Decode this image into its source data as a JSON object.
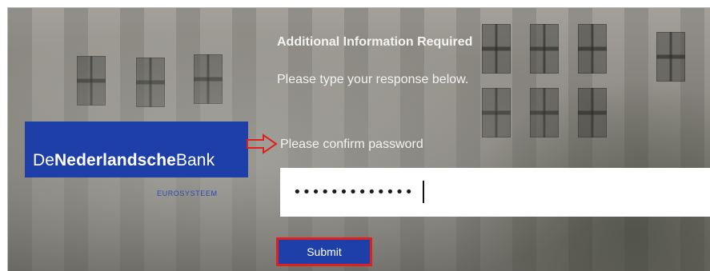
{
  "form": {
    "title": "Additional Information Required",
    "subtitle": "Please type your response below.",
    "prompt": "Please confirm password",
    "password_value": "•••••••••••••",
    "submit_label": "Submit"
  },
  "logo": {
    "part1": "De",
    "part2": "Nederlandsche",
    "part3": "Bank",
    "tagline": "EUROSYSTEEM"
  },
  "colors": {
    "brand_blue": "#1f3fa8",
    "highlight_red": "#e02020",
    "text_light": "#f3f3f0"
  },
  "icons": {
    "annotation_arrow": "arrow-right-icon"
  }
}
